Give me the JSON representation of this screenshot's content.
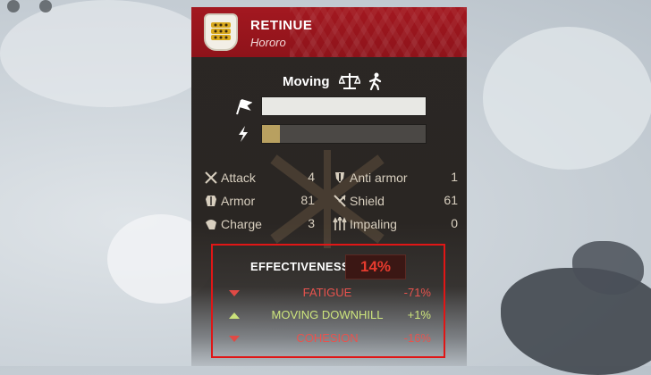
{
  "unit": {
    "title": "RETINUE",
    "subtitle": "Hororo"
  },
  "state": {
    "label": "Moving",
    "icons": [
      "scales-icon",
      "walking-person-icon"
    ]
  },
  "bars": [
    {
      "icon": "flag-icon",
      "fraction": 1.0,
      "color": "#e8e8e4"
    },
    {
      "icon": "lightning-icon",
      "fraction": 0.11,
      "color": "#b8a060"
    }
  ],
  "stats": [
    {
      "icon": "crossed-swords-icon",
      "label": "Attack",
      "value": "4"
    },
    {
      "icon": "anti-armor-icon",
      "label": "Anti armor",
      "value": "1"
    },
    {
      "icon": "armor-icon",
      "label": "Armor",
      "value": "81"
    },
    {
      "icon": "shield-icon",
      "label": "Shield",
      "value": "61"
    },
    {
      "icon": "charge-icon",
      "label": "Charge",
      "value": "3"
    },
    {
      "icon": "impaling-icon",
      "label": "Impaling",
      "value": "0"
    }
  ],
  "effectiveness": {
    "title": "EFFECTIVENESS",
    "value": "14%",
    "value_color": "#e63b2e",
    "modifiers": [
      {
        "direction": "down",
        "label": "FATIGUE",
        "value": "-71%",
        "color": "#e8534e"
      },
      {
        "direction": "up",
        "label": "MOVING DOWNHILL",
        "value": "+1%",
        "color": "#cde57c"
      },
      {
        "direction": "down",
        "label": "COHESION",
        "value": "-16%",
        "color": "#e8534e"
      }
    ]
  },
  "colors": {
    "banner": "#a31820",
    "highlight_border": "#e01616",
    "panel": "#2b2724"
  }
}
